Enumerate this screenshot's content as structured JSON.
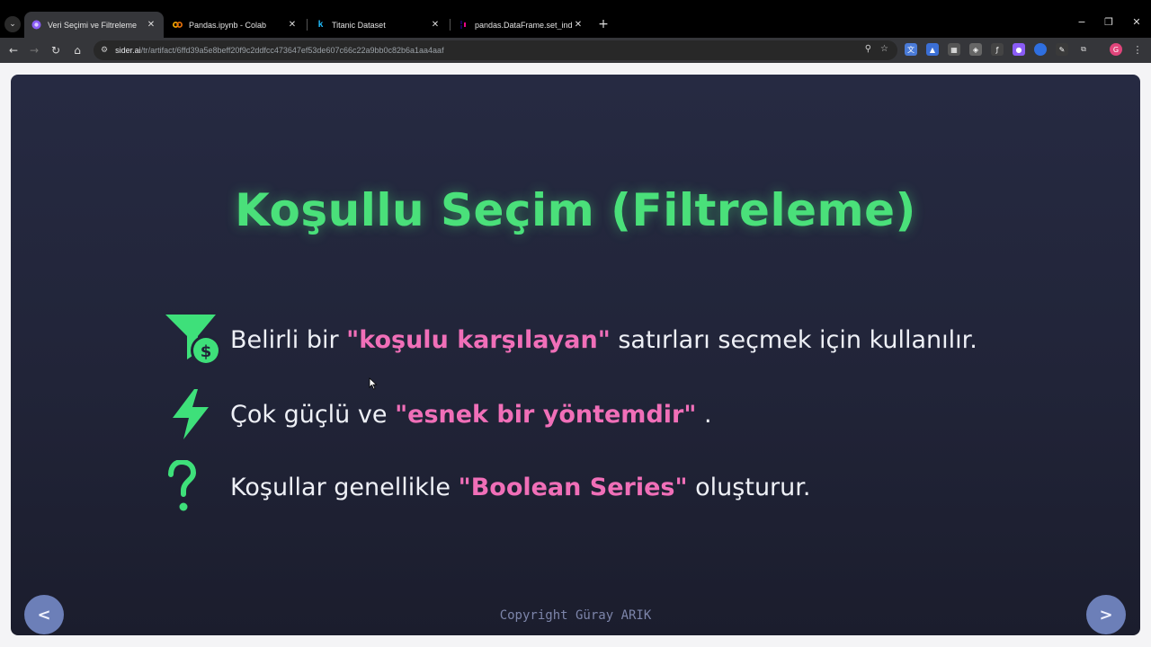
{
  "browser": {
    "tabs": [
      {
        "title": "Veri Seçimi ve Filtreleme",
        "favicon": "sider-icon",
        "active": true
      },
      {
        "title": "Pandas.ipynb - Colab",
        "favicon": "colab-icon",
        "active": false
      },
      {
        "title": "Titanic Dataset",
        "favicon": "kaggle-icon",
        "active": false
      },
      {
        "title": "pandas.DataFrame.set_index —",
        "favicon": "pandas-icon",
        "active": false
      }
    ],
    "tab_close_glyph": "✕",
    "new_tab_glyph": "+",
    "url_host": "sider.ai",
    "url_path": "/tr/artifact/6ffd39a5e8beff20f9c2ddfcc473647ef53de607c66c22a9bb0c82b6a1aa4aaf",
    "profile_initial": "G"
  },
  "slide": {
    "title": "Koşullu Seçim (Filtreleme)",
    "bullets": [
      {
        "icon": "funnel-dollar-icon",
        "before": "Belirli bir",
        "highlight": "\"koşulu karşılayan\"",
        "after": "satırları seçmek için kullanılır."
      },
      {
        "icon": "lightning-bolt-icon",
        "before": "Çok güçlü ve",
        "highlight": "\"esnek bir yöntemdir\"",
        "after": "."
      },
      {
        "icon": "question-mark-icon",
        "before": "Koşullar genellikle",
        "highlight": "\"Boolean Series\"",
        "after": "oluşturur."
      }
    ],
    "prev_label": "<",
    "next_label": ">",
    "copyright": "Copyright Güray ARIK"
  },
  "colors": {
    "title_green": "#4ae07a",
    "highlight_pink": "#f06fb8",
    "slide_bg": "#232639",
    "nav_button": "#6c7fb8"
  }
}
